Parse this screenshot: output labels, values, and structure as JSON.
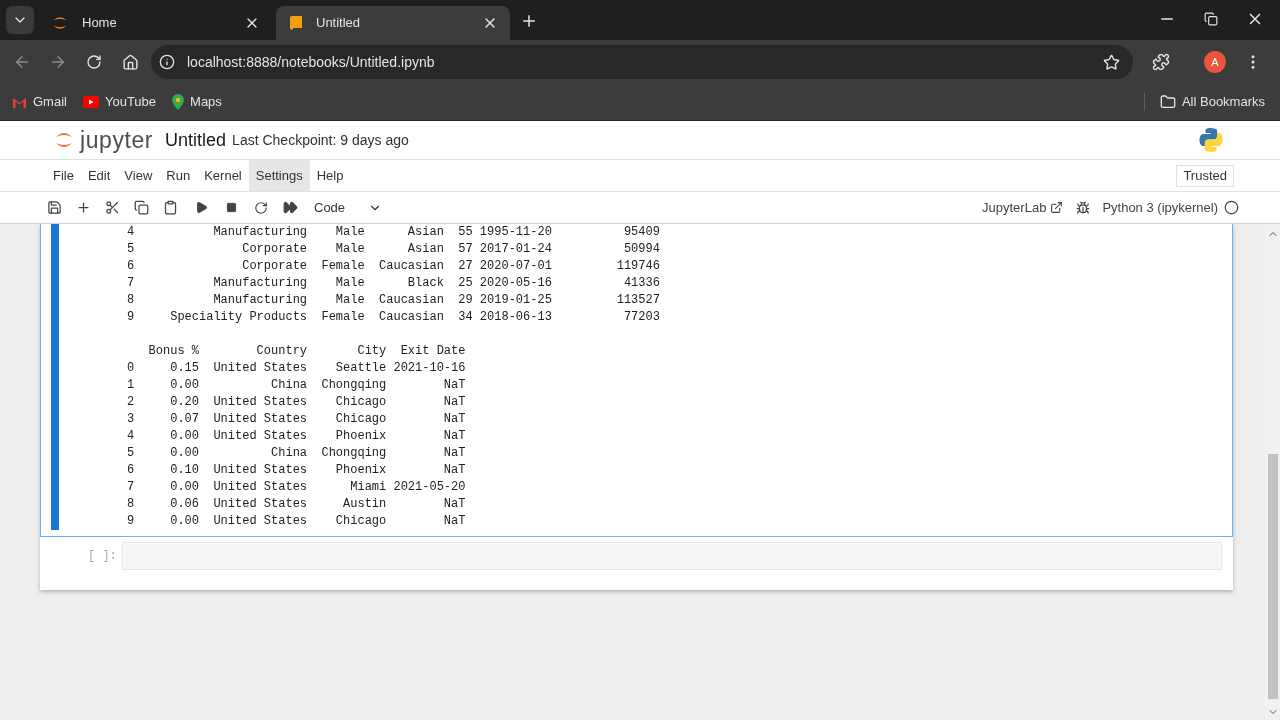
{
  "browser": {
    "tabs": [
      {
        "title": "Home",
        "selected": false,
        "kind": "home"
      },
      {
        "title": "Untitled",
        "selected": true,
        "kind": "notebook"
      }
    ],
    "url": "localhost:8888/notebooks/Untitled.ipynb",
    "bookmarks": [
      "Gmail",
      "YouTube",
      "Maps"
    ],
    "all_bookmarks": "All Bookmarks",
    "avatar": "A"
  },
  "notebook": {
    "app_name": "jupyter",
    "title": "Untitled",
    "checkpoint": "Last Checkpoint: 9 days ago",
    "menu": [
      {
        "label": "File",
        "selected": false
      },
      {
        "label": "Edit",
        "selected": false
      },
      {
        "label": "View",
        "selected": false
      },
      {
        "label": "Run",
        "selected": false
      },
      {
        "label": "Kernel",
        "selected": false
      },
      {
        "label": "Settings",
        "selected": true
      },
      {
        "label": "Help",
        "selected": false
      }
    ],
    "trusted": "Trusted",
    "cell_type": "Code",
    "jupyterlab_link": "JupyterLab",
    "kernel": "Python 3 (ipykernel)",
    "output_blocks": [
      [
        "4           Manufacturing    Male      Asian  55 1995-11-20          95409",
        "5               Corporate    Male      Asian  57 2017-01-24          50994",
        "6               Corporate  Female  Caucasian  27 2020-07-01         119746",
        "7           Manufacturing    Male      Black  25 2020-05-16          41336",
        "8           Manufacturing    Male  Caucasian  29 2019-01-25         113527",
        "9     Speciality Products  Female  Caucasian  34 2018-06-13          77203"
      ],
      [
        "   Bonus %        Country       City  Exit Date",
        "0     0.15  United States    Seattle 2021-10-16",
        "1     0.00          China  Chongqing        NaT",
        "2     0.20  United States    Chicago        NaT",
        "3     0.07  United States    Chicago        NaT",
        "4     0.00  United States    Phoenix        NaT",
        "5     0.00          China  Chongqing        NaT",
        "6     0.10  United States    Phoenix        NaT",
        "7     0.00  United States      Miami 2021-05-20",
        "8     0.06  United States     Austin        NaT",
        "9     0.00  United States    Chicago        NaT"
      ]
    ],
    "empty_cell_prompt": "[ ]:"
  }
}
